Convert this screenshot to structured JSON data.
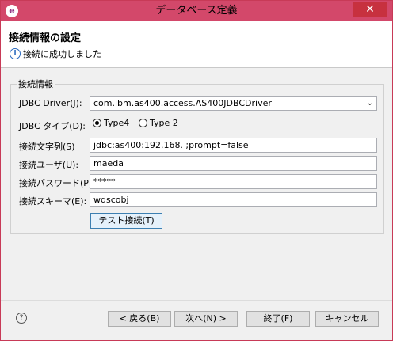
{
  "window": {
    "title": "データベース定義",
    "close_label": "✕"
  },
  "header": {
    "title": "接続情報の設定",
    "message": "接続に成功しました"
  },
  "group": {
    "legend": "接続情報"
  },
  "fields": {
    "driver": {
      "label": "JDBC Driver(J):",
      "value": "com.ibm.as400.access.AS400JDBCDriver"
    },
    "type": {
      "label": "JDBC タイプ(D):",
      "options": [
        "Type4",
        "Type 2"
      ],
      "selected": "Type4"
    },
    "url": {
      "label": "接続文字列(S)",
      "value": "jdbc:as400:192.168.   ;prompt=false"
    },
    "user": {
      "label": "接続ユーザ(U):",
      "value": "maeda"
    },
    "password": {
      "label": "接続パスワード(P):",
      "value": "*****"
    },
    "schema": {
      "label": "接続スキーマ(E):",
      "value": "wdscobj"
    }
  },
  "buttons": {
    "test": "テスト接続(T)",
    "back": "< 戻る(B)",
    "next": "次へ(N) >",
    "finish": "終了(F)",
    "cancel": "キャンセル"
  },
  "icons": {
    "app": "eclipse-icon",
    "info": "info-icon",
    "help": "help-icon"
  },
  "colors": {
    "titlebar": "#d3486a",
    "close": "#c7313f"
  }
}
